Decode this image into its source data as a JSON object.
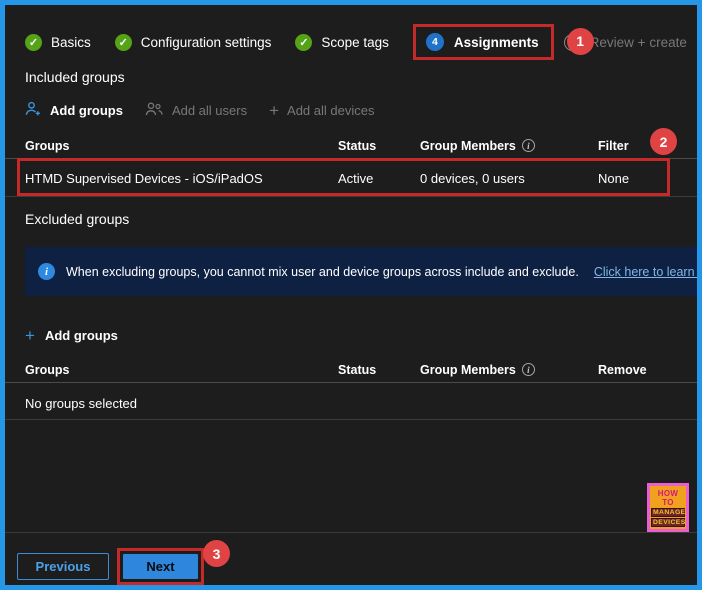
{
  "icons": {
    "check": "✓",
    "plus": "+",
    "info": "i"
  },
  "wizard": {
    "steps": [
      {
        "label": "Basics"
      },
      {
        "label": "Configuration settings"
      },
      {
        "label": "Scope tags"
      },
      {
        "label": "Assignments",
        "number": "4"
      },
      {
        "label": "Review + create"
      }
    ]
  },
  "annotations": {
    "badges": [
      "1",
      "2",
      "3"
    ]
  },
  "included": {
    "title": "Included groups",
    "actions": {
      "add_groups": "Add groups",
      "add_all_users": "Add all users",
      "add_all_devices": "Add all devices"
    },
    "table": {
      "headers": {
        "groups": "Groups",
        "status": "Status",
        "members": "Group Members",
        "filter": "Filter"
      },
      "row": {
        "group": "HTMD Supervised Devices - iOS/iPadOS",
        "status": "Active",
        "members": "0 devices, 0 users",
        "filter": "None"
      }
    }
  },
  "excluded": {
    "title": "Excluded groups",
    "info_text": "When excluding groups, you cannot mix user and device groups across include and exclude.",
    "info_link": "Click here to learn more abo",
    "add_groups": "Add groups",
    "table": {
      "headers": {
        "groups": "Groups",
        "status": "Status",
        "members": "Group Members",
        "remove": "Remove"
      },
      "empty_text": "No groups selected"
    }
  },
  "footer": {
    "previous": "Previous",
    "next": "Next"
  },
  "logo": {
    "line1": "HOW TO",
    "line2": "MANAGE",
    "line3": "DEVICES"
  },
  "colors": {
    "frame_border": "#2596e8",
    "annotation_red": "#c52a2a",
    "badge_red": "#e04343",
    "step_complete_green": "#55a317",
    "step_current_blue": "#2173c9",
    "accent_blue": "#3a96dd",
    "primary_button_blue": "#2e86dd",
    "banner_bg": "#0e2142",
    "link_blue": "#82b6e8",
    "panel_bg": "#1e1d1d"
  }
}
